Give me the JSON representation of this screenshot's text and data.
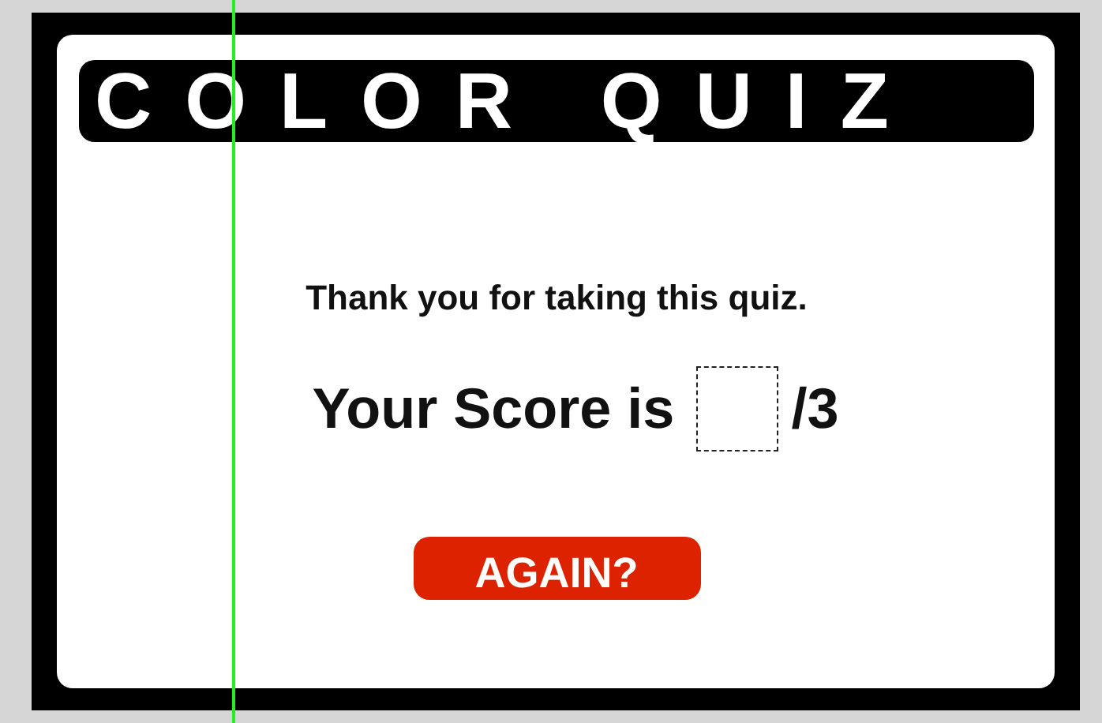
{
  "title": "COLOR QUIZ",
  "message": "Thank you for taking this quiz.",
  "score": {
    "label": "Your Score is",
    "total": "/3"
  },
  "buttons": [
    "AGAIN?"
  ]
}
